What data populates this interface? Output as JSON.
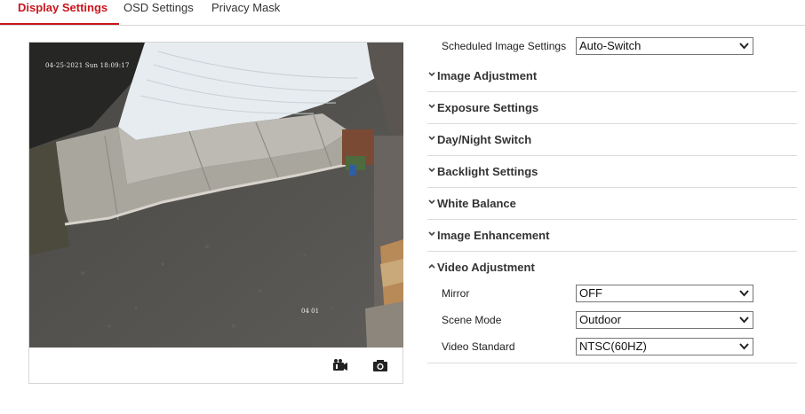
{
  "tabs": [
    {
      "label": "Display Settings"
    },
    {
      "label": "OSD Settings"
    },
    {
      "label": "Privacy Mask"
    }
  ],
  "preview": {
    "osd_time": "04-25-2021 Sun 18:09:17",
    "osd_name": "04 01",
    "record_icon": "record-video-icon",
    "snapshot_icon": "camera-snapshot-icon"
  },
  "scheduled": {
    "label": "Scheduled Image Settings",
    "value": "Auto-Switch"
  },
  "sections": [
    {
      "title": "Image Adjustment",
      "expanded": false
    },
    {
      "title": "Exposure Settings",
      "expanded": false
    },
    {
      "title": "Day/Night Switch",
      "expanded": false
    },
    {
      "title": "Backlight Settings",
      "expanded": false
    },
    {
      "title": "White Balance",
      "expanded": false
    },
    {
      "title": "Image Enhancement",
      "expanded": false
    },
    {
      "title": "Video Adjustment",
      "expanded": true
    }
  ],
  "video_adjustment": {
    "mirror": {
      "label": "Mirror",
      "value": "OFF"
    },
    "scene_mode": {
      "label": "Scene Mode",
      "value": "Outdoor"
    },
    "video_standard": {
      "label": "Video Standard",
      "value": "NTSC(60HZ)"
    }
  },
  "colors": {
    "accent": "#c8161d",
    "divider": "#dcdcdc"
  }
}
